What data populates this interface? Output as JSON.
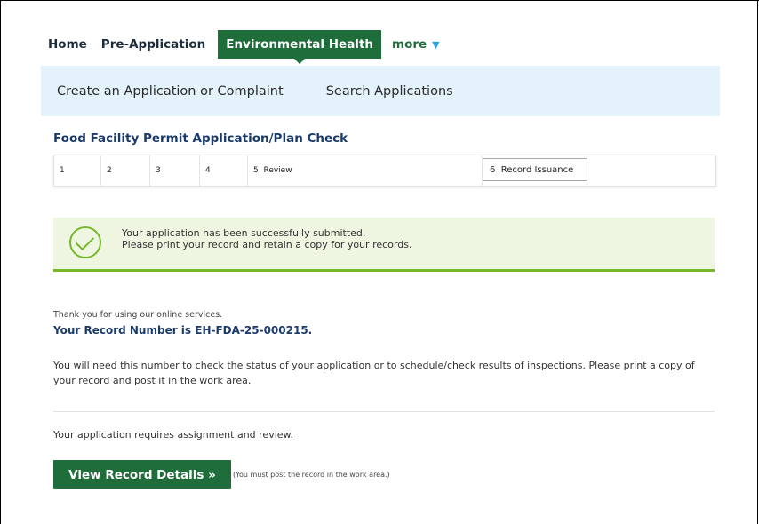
{
  "nav": {
    "items": [
      "Home",
      "Pre-Application",
      "Environmental Health",
      "more"
    ],
    "active_index": 2
  },
  "subnav": {
    "items": [
      "Create an Application or Complaint",
      "Search Applications"
    ]
  },
  "page_title": "Food Facility Permit Application/Plan Check",
  "steps": [
    {
      "num": "1",
      "label": ""
    },
    {
      "num": "2",
      "label": ""
    },
    {
      "num": "3",
      "label": ""
    },
    {
      "num": "4",
      "label": ""
    },
    {
      "num": "5",
      "label": "Review"
    },
    {
      "num": "6",
      "label": "Record Issuance"
    }
  ],
  "success": {
    "line1": "Your application has been successfully submitted.",
    "line2": "Please print your record and retain a copy for your records."
  },
  "thanks": "Thank you for using our online services.",
  "record": {
    "prefix": "Your Record Number is ",
    "number": "EH-FDA-25-000215."
  },
  "instructions": "You will need this number to check the status of your application or to schedule/check results of inspections. Please print a copy of your record and post it in the work area.",
  "requires": "Your application requires assignment and review.",
  "view_button": "View Record Details »",
  "note": "(You must post the record in the work area.)",
  "colors": {
    "accent_green": "#1f6d3a",
    "success_green": "#76b82a",
    "subnav_bg": "#e4f2fb",
    "title_blue": "#1a3a6a",
    "caret_blue": "#2aa0dc"
  }
}
